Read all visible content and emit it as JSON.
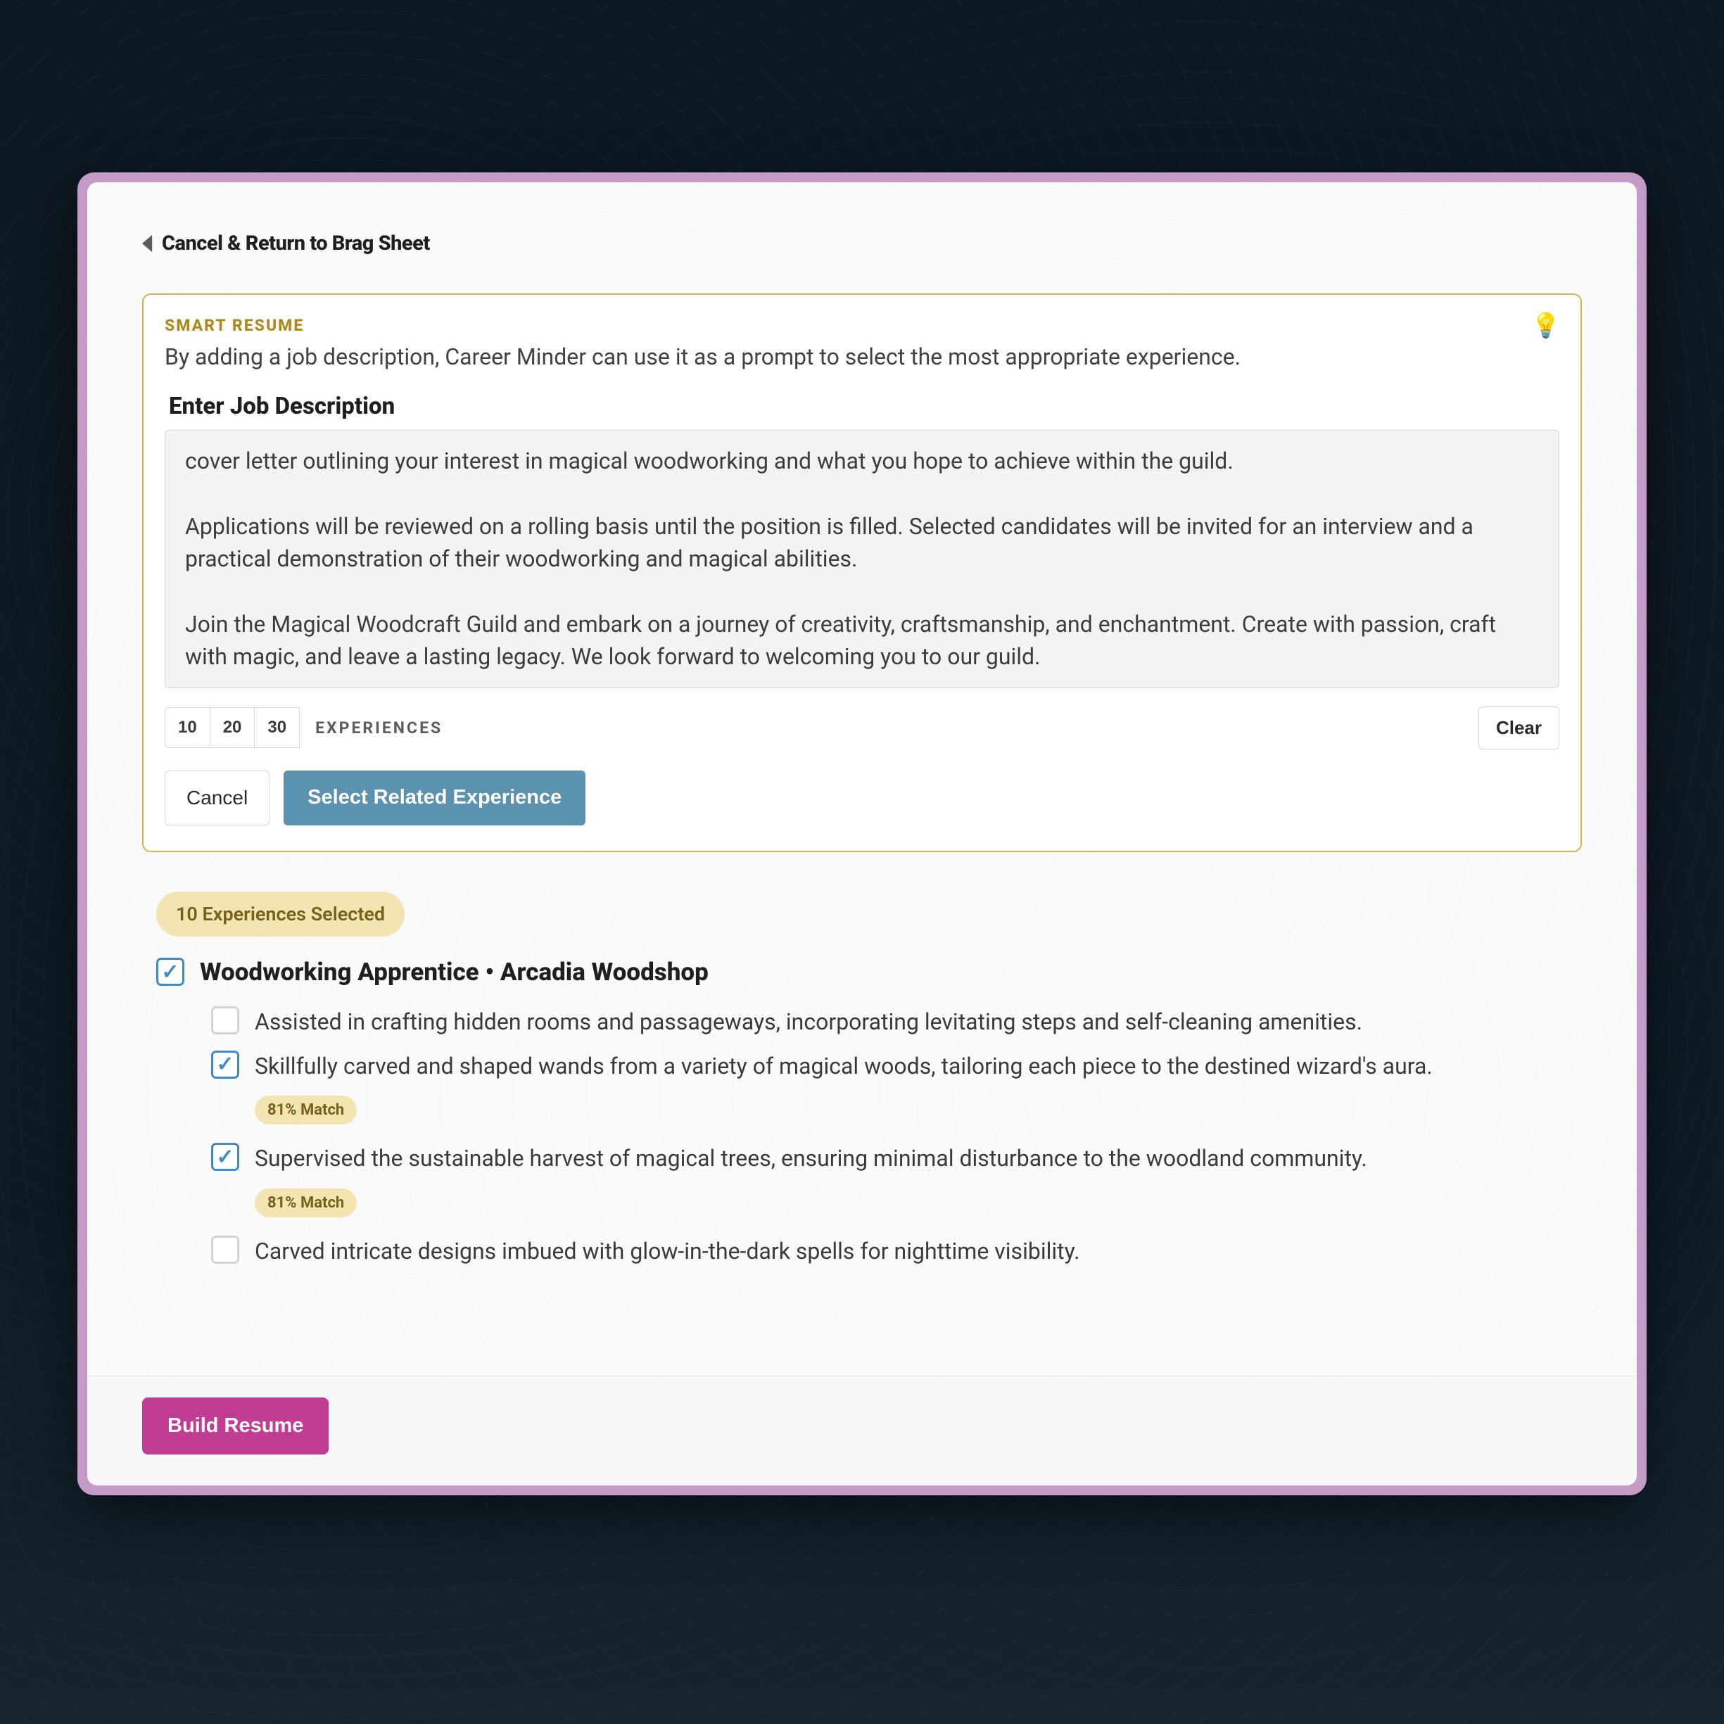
{
  "back": {
    "label": "Cancel & Return to Brag Sheet"
  },
  "card": {
    "badge": "SMART RESUME",
    "subtitle": "By adding a job description, Career Minder can use it as a prompt to select the most appropriate experience.",
    "section_label": "Enter Job Description",
    "textarea_value": "cover letter outlining your interest in magical woodworking and what you hope to achieve within the guild.\n\nApplications will be reviewed on a rolling basis until the position is filled. Selected candidates will be invited for an interview and a practical demonstration of their woodworking and magical abilities.\n\nJoin the Magical Woodcraft Guild and embark on a journey of creativity, craftsmanship, and enchantment. Create with passion, craft with magic, and leave a lasting legacy. We look forward to welcoming you to our guild.",
    "seg1": "10",
    "seg2": "20",
    "seg3": "30",
    "experiences_label": "EXPERIENCES",
    "clear": "Clear",
    "cancel": "Cancel",
    "select": "Select Related Experience",
    "bulb_icon": "bulb-icon"
  },
  "selected": {
    "pill": "10 Experiences Selected",
    "job_title": "Woodworking Apprentice • Arcadia Woodshop",
    "items": [
      {
        "checked": false,
        "text": "Assisted in crafting hidden rooms and passageways, incorporating levitating steps and self-cleaning amenities.",
        "match": null
      },
      {
        "checked": true,
        "text": "Skillfully carved and shaped wands from a variety of magical woods, tailoring each piece to the destined wizard's aura.",
        "match": "81% Match"
      },
      {
        "checked": true,
        "text": "Supervised the sustainable harvest of magical trees, ensuring minimal disturbance to the woodland community.",
        "match": "81% Match"
      },
      {
        "checked": false,
        "text": "Carved intricate designs imbued with glow-in-the-dark spells for nighttime visibility.",
        "match": null
      }
    ]
  },
  "footer": {
    "build": "Build Resume"
  },
  "colors": {
    "accent_gold": "#d6b24d",
    "accent_blue": "#5b92af",
    "accent_magenta": "#c13c93",
    "checkbox_blue": "#3d8bc8"
  }
}
